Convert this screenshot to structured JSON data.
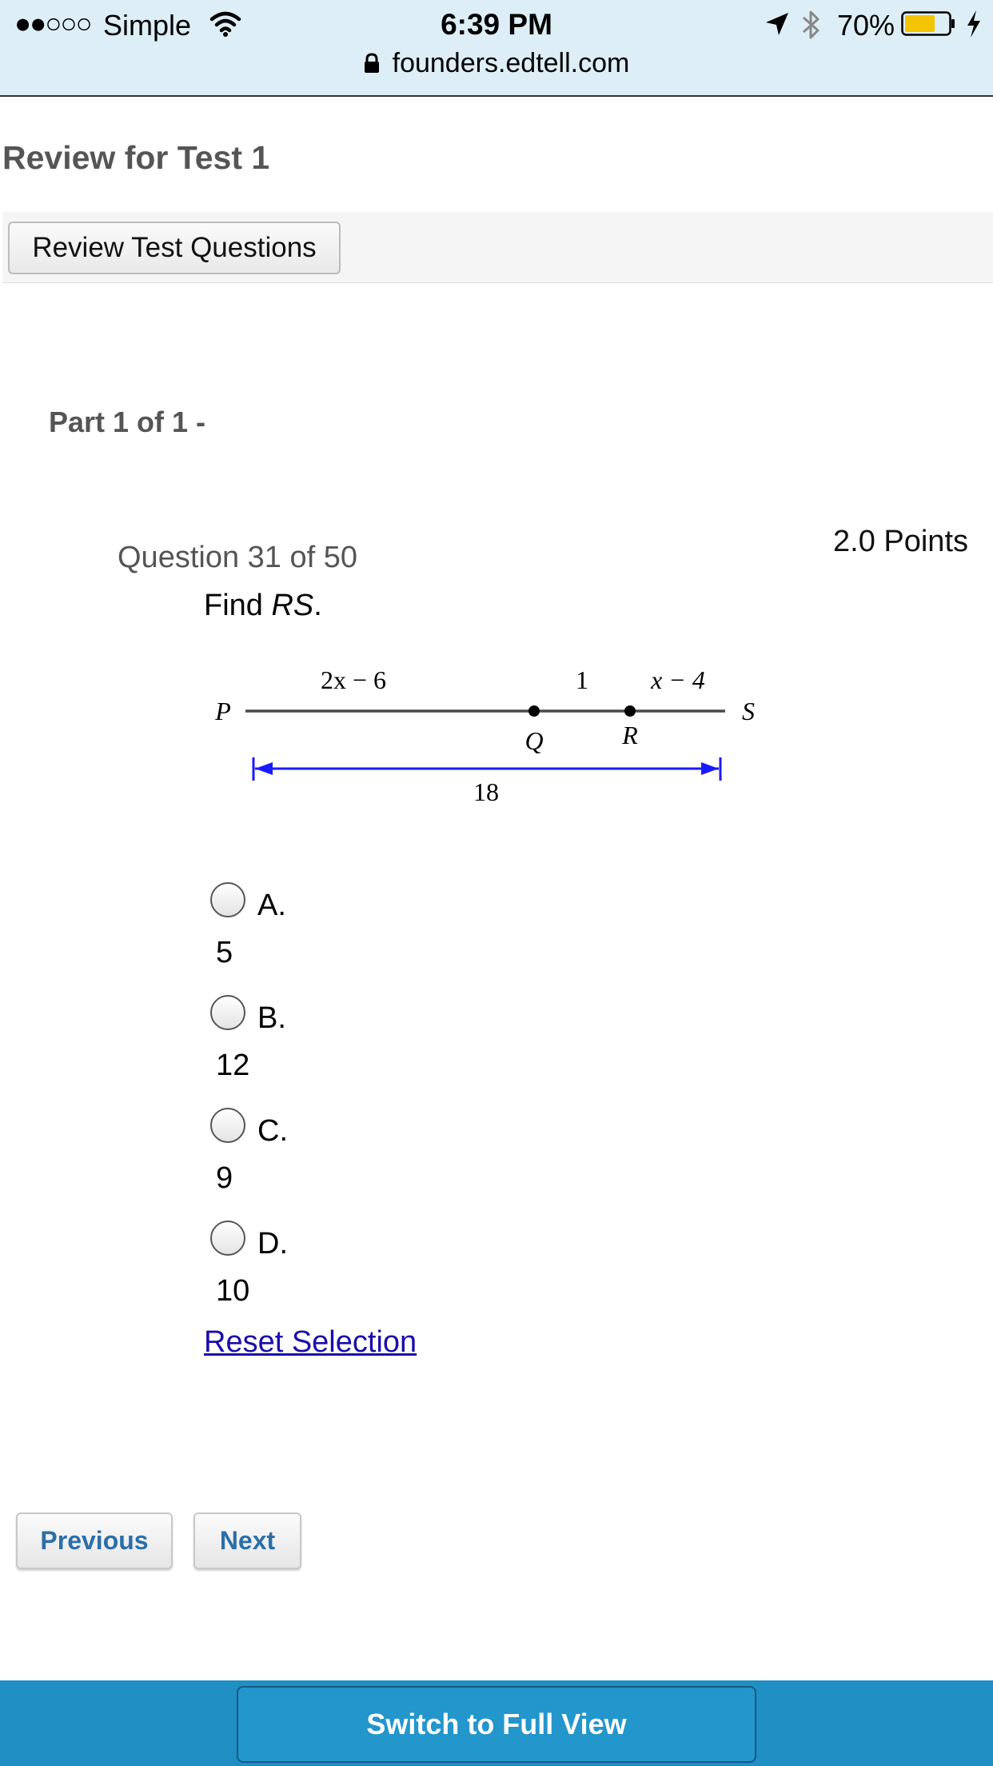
{
  "status_bar": {
    "signal": "●●○○○",
    "carrier": "Simple",
    "time": "6:39 PM",
    "battery_percent": "70%",
    "battery_level": 0.7,
    "battery_color": "#f5c400",
    "url": "founders.edtell.com",
    "icons": [
      "wifi-icon",
      "location-arrow-icon",
      "bluetooth-icon",
      "battery-icon",
      "charging-bolt-icon",
      "lock-icon"
    ]
  },
  "page": {
    "title": "Review for Test 1",
    "review_button": "Review Test Questions",
    "part_label": "Part 1 of 1 -"
  },
  "question": {
    "number_text": "Question 31 of 50",
    "points": "2.0 Points",
    "prompt_prefix": "Find ",
    "prompt_var": "RS",
    "prompt_suffix": ".",
    "diagram": {
      "label_p": "P",
      "label_q": "Q",
      "label_r": "R",
      "label_s": "S",
      "label_pq": "2x − 6",
      "label_qr": "1",
      "label_rs": "x − 4",
      "label_total": "18",
      "arrow_color": "#1a1aff"
    },
    "choices": [
      {
        "letter": "A.",
        "value": "5"
      },
      {
        "letter": "B.",
        "value": "12"
      },
      {
        "letter": "C.",
        "value": "9"
      },
      {
        "letter": "D.",
        "value": "10"
      }
    ],
    "reset_link": "Reset Selection"
  },
  "navigation": {
    "previous": "Previous",
    "next": "Next"
  },
  "footer": {
    "switch_view": "Switch to Full View",
    "color": "#1f8fc4"
  }
}
